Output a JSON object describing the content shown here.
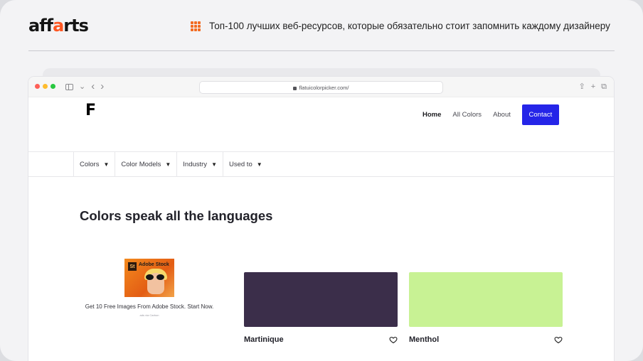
{
  "page": {
    "logo": {
      "main_left": "aff",
      "dot_letter": "a",
      "main_right": "rts"
    },
    "tagline": "Топ-100 лучших веб-ресурсов, которые обязательно стоит запомнить каждому дизайнеру",
    "colors": {
      "accent": "#f26b21",
      "card_bg": "#f3f3f5"
    }
  },
  "browser": {
    "url": "flatuicolorpicker.com/",
    "nav_back": "‹",
    "nav_forward": "›",
    "chevron_down": "⌄",
    "actions": [
      "⇪",
      "+",
      "⧉"
    ]
  },
  "site": {
    "logo": "F",
    "nav": {
      "items": [
        "Home",
        "All Colors",
        "About"
      ],
      "contact": "Contact",
      "contact_color": "#2525e8"
    },
    "filters": [
      {
        "label": "Colors",
        "arrow": "▼"
      },
      {
        "label": "Color Models",
        "arrow": "▼"
      },
      {
        "label": "Industry",
        "arrow": "▼"
      },
      {
        "label": "Used to",
        "arrow": "▼"
      }
    ],
    "headline": "Colors speak all the languages",
    "ad": {
      "badge": "St",
      "brand": "Adobe Stock",
      "text": "Get 10 Free Images From Adobe Stock. Start Now.",
      "small": "ads via Carbon"
    },
    "swatches": [
      {
        "name": "Martinique",
        "color": "#3b2e4a"
      },
      {
        "name": "Menthol",
        "color": "#c8f294"
      }
    ]
  }
}
